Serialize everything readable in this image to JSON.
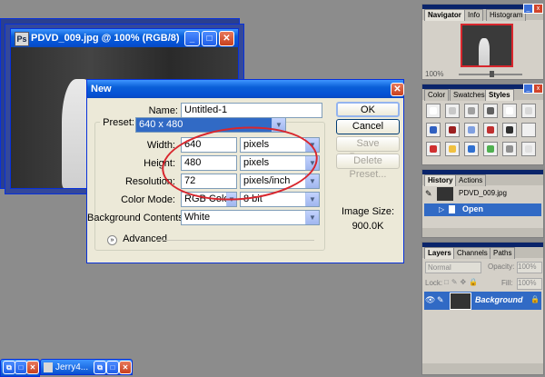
{
  "documents": [
    {
      "title": "PDVD_009.jpg @ 100% (RGB/8)"
    }
  ],
  "dialog": {
    "title": "New",
    "name_label": "Name:",
    "name_value": "Untitled-1",
    "preset_label": "Preset:",
    "preset_value": "640 x 480",
    "width_label": "Width:",
    "width_value": "640",
    "width_unit": "pixels",
    "height_label": "Height:",
    "height_value": "480",
    "height_unit": "pixels",
    "resolution_label": "Resolution:",
    "resolution_value": "72",
    "resolution_unit": "pixels/inch",
    "color_mode_label": "Color Mode:",
    "color_mode_value": "RGB Color",
    "bit_depth_value": "8 bit",
    "background_label": "Background Contents:",
    "background_value": "White",
    "advanced_label": "Advanced",
    "ok_label": "OK",
    "cancel_label": "Cancel",
    "save_preset_label": "Save Preset...",
    "delete_preset_label": "Delete Preset...",
    "image_size_label": "Image Size:",
    "image_size_value": "900.0K"
  },
  "navigator_panel": {
    "tabs": [
      "Navigator",
      "Info",
      "Histogram"
    ],
    "zoom": "100%"
  },
  "styles_panel": {
    "tabs": [
      "Color",
      "Swatches",
      "Styles"
    ],
    "swatch_colors": [
      "#ffffff",
      "#c8c8c8",
      "#a0a0a0",
      "#606060",
      "#ffffff",
      "#d8d8d8",
      "#3060c0",
      "#9c2020",
      "#80a0e0",
      "#c03030",
      "#303030",
      "#f0f0f0",
      "#d03030",
      "#f0c040",
      "#3070d0",
      "#50b050",
      "#909090",
      "#e0e0e0"
    ]
  },
  "history_panel": {
    "tabs": [
      "History",
      "Actions"
    ],
    "snapshot": "PDVD_009.jpg",
    "step": "Open"
  },
  "layers_panel": {
    "tabs": [
      "Layers",
      "Channels",
      "Paths"
    ],
    "blend_mode": "Normal",
    "opacity_label": "Opacity:",
    "opacity_value": "100%",
    "lock_label": "Lock:",
    "fill_label": "Fill:",
    "fill_value": "100%",
    "layer_name": "Background"
  },
  "minimized": [
    {
      "title": "Jerry4..."
    }
  ],
  "colors": {
    "accent": "#d8262d",
    "selection": "#316ac5"
  }
}
